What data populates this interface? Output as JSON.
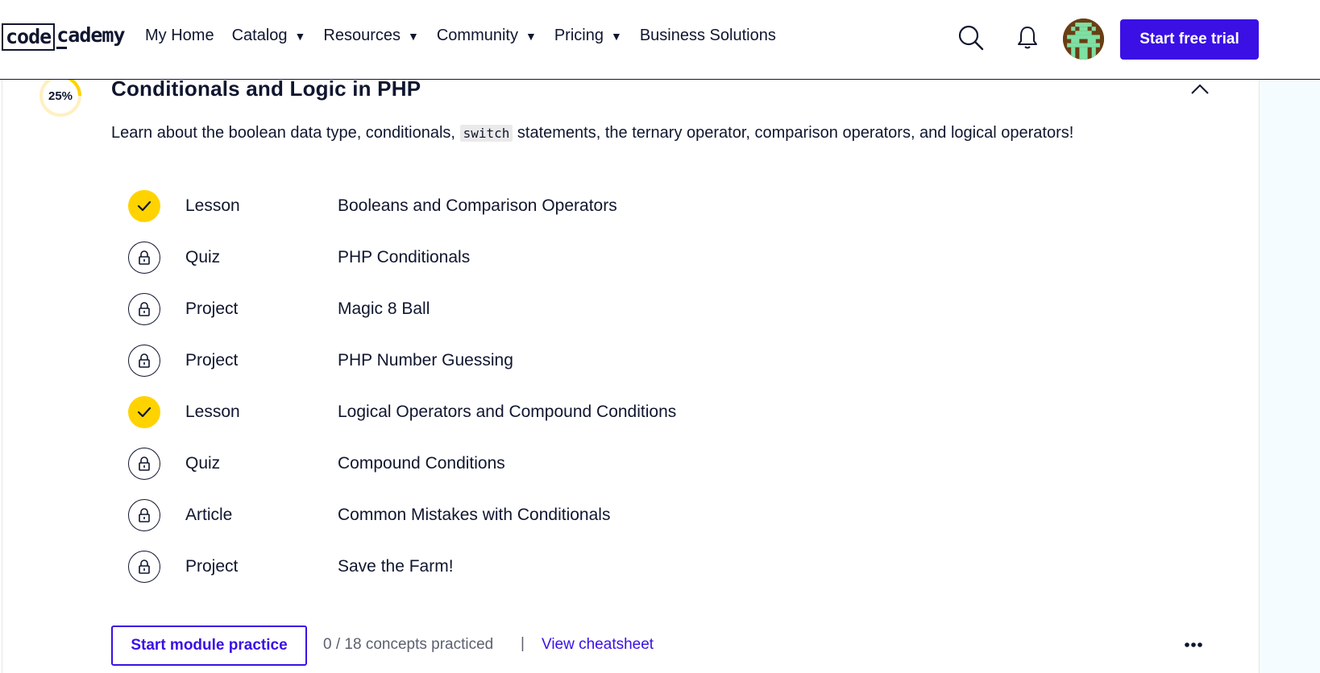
{
  "header": {
    "logo": {
      "boxed": "code",
      "rest": "cademy"
    },
    "nav": [
      {
        "label": "My Home",
        "dropdown": false
      },
      {
        "label": "Catalog",
        "dropdown": true
      },
      {
        "label": "Resources",
        "dropdown": true
      },
      {
        "label": "Community",
        "dropdown": true
      },
      {
        "label": "Pricing",
        "dropdown": true
      },
      {
        "label": "Business Solutions",
        "dropdown": false
      }
    ],
    "caret": "▼",
    "icons": {
      "search": "search-icon",
      "notifications": "bell-icon",
      "avatar": "avatar"
    },
    "cta": "Start free trial"
  },
  "module": {
    "progress_label": "25%",
    "progress": 0.25,
    "title": "Conditionals and Logic in PHP",
    "description_before": "Learn about the boolean data type, conditionals, ",
    "description_code": "switch",
    "description_after": " statements, the ternary operator, comparison operators, and logical operators!",
    "items": [
      {
        "status": "completed",
        "type": "Lesson",
        "name": "Booleans and Comparison Operators"
      },
      {
        "status": "locked",
        "type": "Quiz",
        "name": "PHP Conditionals"
      },
      {
        "status": "locked",
        "type": "Project",
        "name": "Magic 8 Ball"
      },
      {
        "status": "locked",
        "type": "Project",
        "name": "PHP Number Guessing"
      },
      {
        "status": "completed",
        "type": "Lesson",
        "name": "Logical Operators and Compound Conditions"
      },
      {
        "status": "locked",
        "type": "Quiz",
        "name": "Compound Conditions"
      },
      {
        "status": "locked",
        "type": "Article",
        "name": "Common Mistakes with Conditionals"
      },
      {
        "status": "locked",
        "type": "Project",
        "name": "Save the Farm!"
      }
    ],
    "footer": {
      "practice_button": "Start module practice",
      "concepts": "0 / 18 concepts practiced",
      "separator": "|",
      "cheatsheet": "View cheatsheet"
    }
  },
  "colors": {
    "brand_primary": "#3a10e5",
    "navy": "#10162f",
    "completed_yellow": "#ffd300",
    "ring_track": "#fff0c2",
    "ring_fill": "#ffd300"
  }
}
